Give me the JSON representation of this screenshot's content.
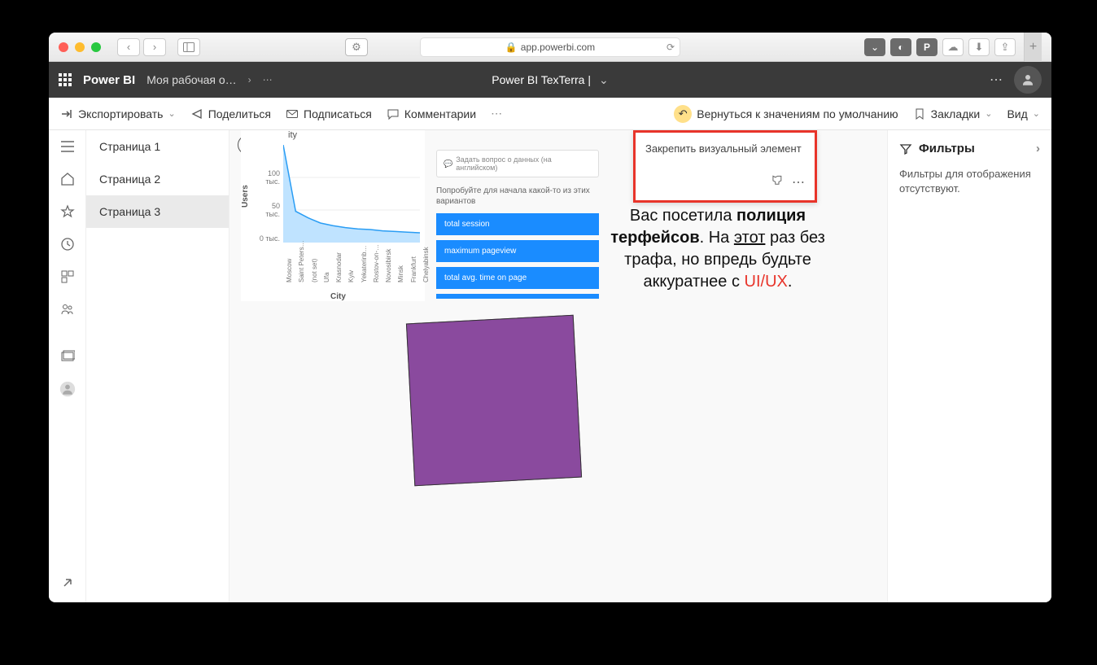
{
  "browser": {
    "url_host": "app.powerbi.com",
    "lock": "🔒"
  },
  "header": {
    "brand": "Power BI",
    "workspace": "Моя рабочая о…",
    "report_title": "Power BI TexTerra"
  },
  "toolbar": {
    "export": "Экспортировать",
    "share": "Поделиться",
    "subscribe": "Подписаться",
    "comments": "Комментарии",
    "reset": "Вернуться к значениям по умолчанию",
    "bookmarks": "Закладки",
    "view": "Вид"
  },
  "pages": {
    "items": [
      "Страница 1",
      "Страница 2",
      "Страница 3"
    ],
    "active": 2
  },
  "qna": {
    "placeholder": "Задать вопрос о данных (на английском)",
    "try_prefix": "Попробуйте для начала какой-то из этих вариантов",
    "suggestions": [
      "total session",
      "maximum pageview",
      "total avg. time on page"
    ]
  },
  "pin": {
    "title": "Закрепить визуальный элемент"
  },
  "joke": {
    "l1a": "Вас посетила ",
    "l1b": "полиция",
    "l2a": "терфейсов",
    "l2b": ". На ",
    "l2c": "этот",
    "l2d": " раз без",
    "l3": "трафа, но впредь будьте",
    "l4a": "аккуратнее с ",
    "l4b": "UI/UX",
    "l4c": "."
  },
  "filters": {
    "title": "Фильтры",
    "empty": "Фильтры для отображения отсутствуют."
  },
  "chart_data": {
    "type": "area",
    "title": "ity",
    "ylabel": "Users",
    "xlabel": "City",
    "ylim": [
      0,
      150000
    ],
    "yticks": [
      "0 тыс.",
      "50 тыс.",
      "100 тыс."
    ],
    "categories": [
      "Moscow",
      "Saint Peters…",
      "(not set)",
      "Ufa",
      "Krasnodar",
      "Kyiv",
      "Yekaterinb…",
      "Rostov-on-…",
      "Novosibirsk",
      "Minsk",
      "Frankfurt",
      "Chelyabinsk"
    ],
    "values": [
      150000,
      48000,
      38000,
      30000,
      26000,
      23000,
      21000,
      20000,
      18000,
      17000,
      16000,
      15000
    ]
  }
}
